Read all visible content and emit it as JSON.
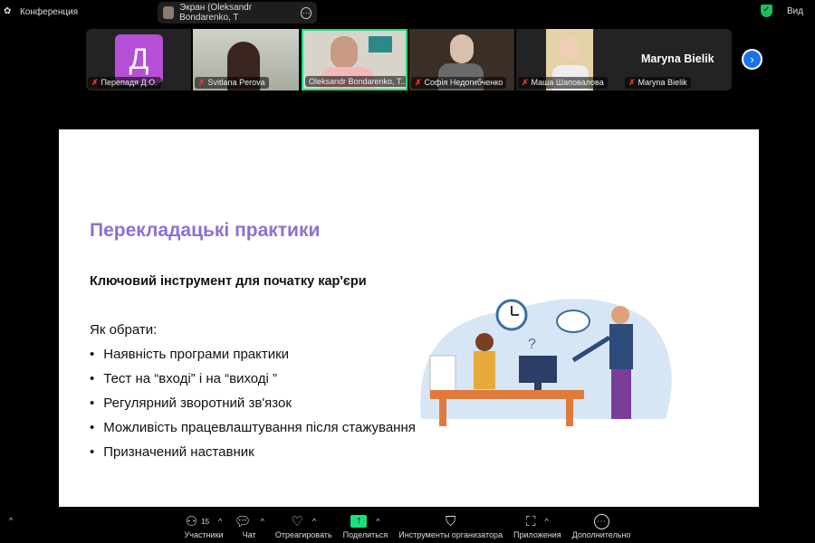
{
  "topbar": {
    "title": "Конференция",
    "share_label": "Экран (Oleksandr Bondarenko, T",
    "view_label": "Вид"
  },
  "participants": [
    {
      "name": "Перепадя Д.О.",
      "initial": "Д"
    },
    {
      "name": "Svitlana Perova"
    },
    {
      "name": "Oleksandr Bondarenko, T..."
    },
    {
      "name": "Софія Недогибченко"
    },
    {
      "name": "Маша Шаповалова"
    },
    {
      "name": "Maryna Bielik",
      "display": "Maryna Bielik"
    }
  ],
  "slide": {
    "title": "Перекладацькі практики",
    "subtitle": "Ключовий інструмент для початку кар'єри",
    "how_label": "Як обрати:",
    "bullets": [
      "Наявність програми практики",
      "Тест на  “вході” і на “виході ”",
      "Регулярний зворотний зв'язок",
      "Можливість працевлаштування після стажування",
      "Призначений наставник"
    ]
  },
  "toolbar": {
    "participants_label": "Участники",
    "participants_count": "15",
    "chat_label": "Чат",
    "react_label": "Отреагировать",
    "share_label": "Поделиться",
    "host_tools_label": "Инструменты организатора",
    "apps_label": "Приложения",
    "more_label": "Дополнительно"
  },
  "colors": {
    "accent_green": "#19e07a",
    "title_purple": "#8c6fd6",
    "avatar_purple": "#b44fd6",
    "next_blue": "#1a73e8"
  }
}
